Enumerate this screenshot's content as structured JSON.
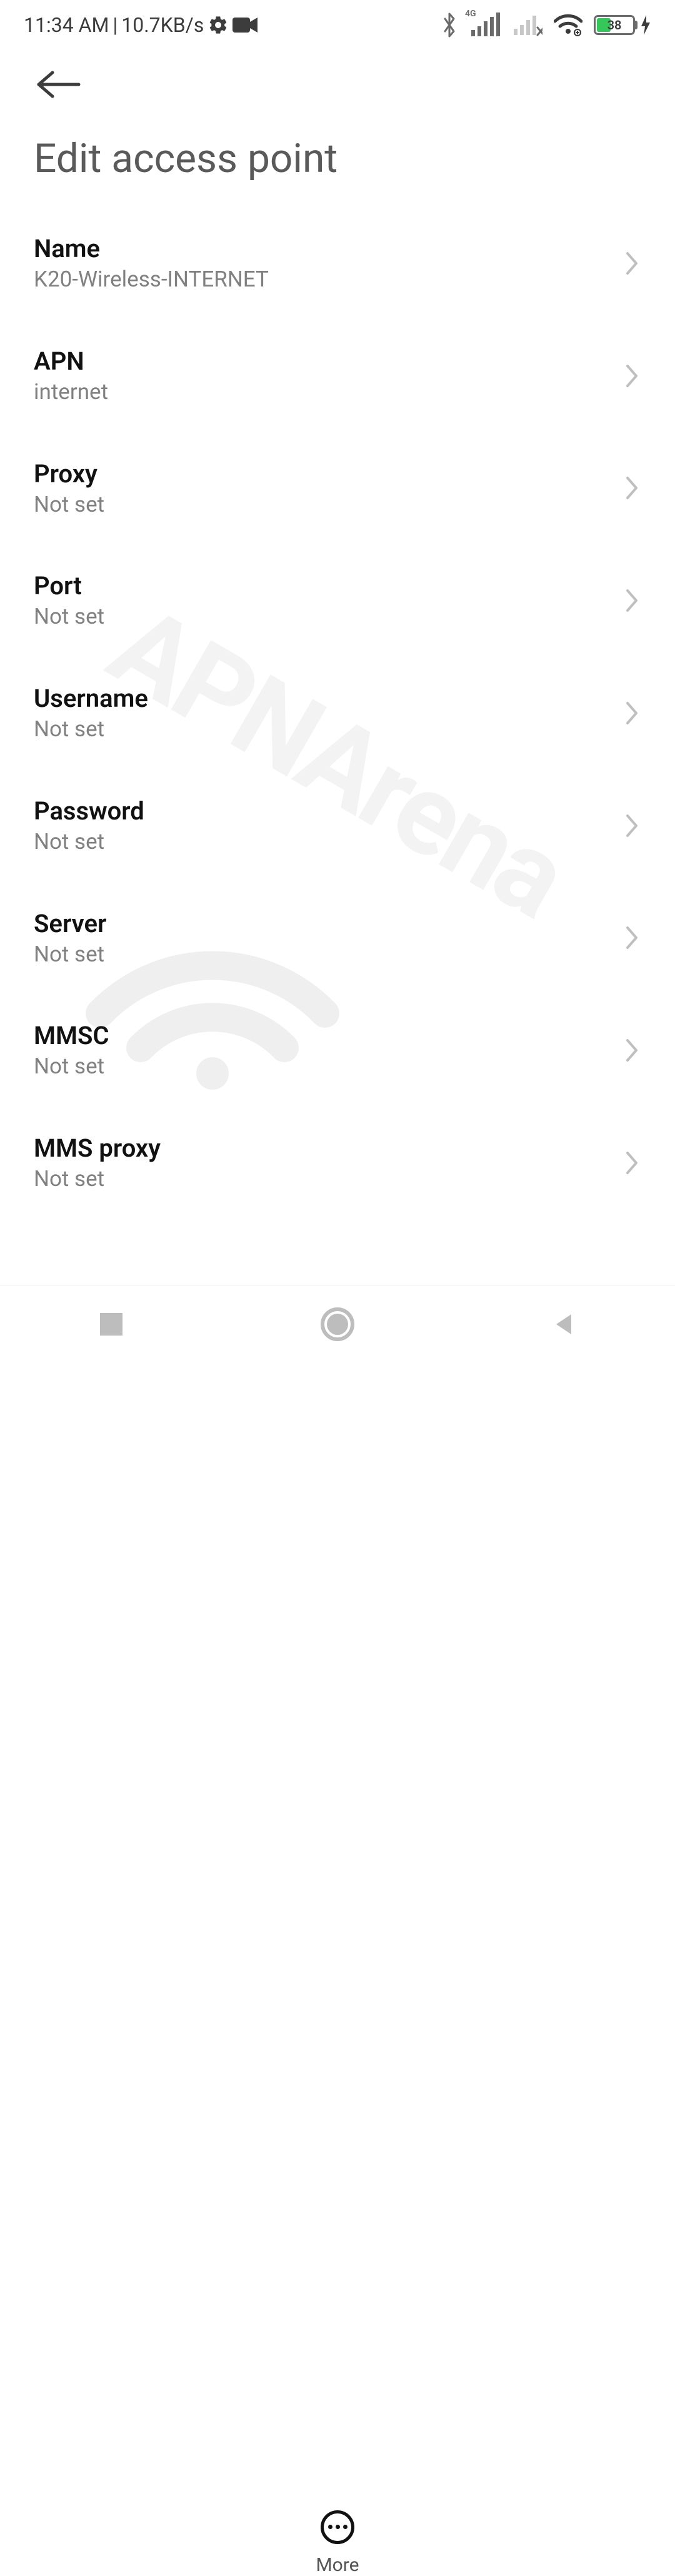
{
  "statusbar": {
    "time": "11:34 AM",
    "sep": "|",
    "speed": "10.7KB/s",
    "battery": "38",
    "network_badge": "4G"
  },
  "header": {
    "title": "Edit access point"
  },
  "settings": [
    {
      "label": "Name",
      "value": "K20-Wireless-INTERNET"
    },
    {
      "label": "APN",
      "value": "internet"
    },
    {
      "label": "Proxy",
      "value": "Not set"
    },
    {
      "label": "Port",
      "value": "Not set"
    },
    {
      "label": "Username",
      "value": "Not set"
    },
    {
      "label": "Password",
      "value": "Not set"
    },
    {
      "label": "Server",
      "value": "Not set"
    },
    {
      "label": "MMSC",
      "value": "Not set"
    },
    {
      "label": "MMS proxy",
      "value": "Not set"
    }
  ],
  "more": {
    "label": "More"
  },
  "watermark": "APNArena"
}
